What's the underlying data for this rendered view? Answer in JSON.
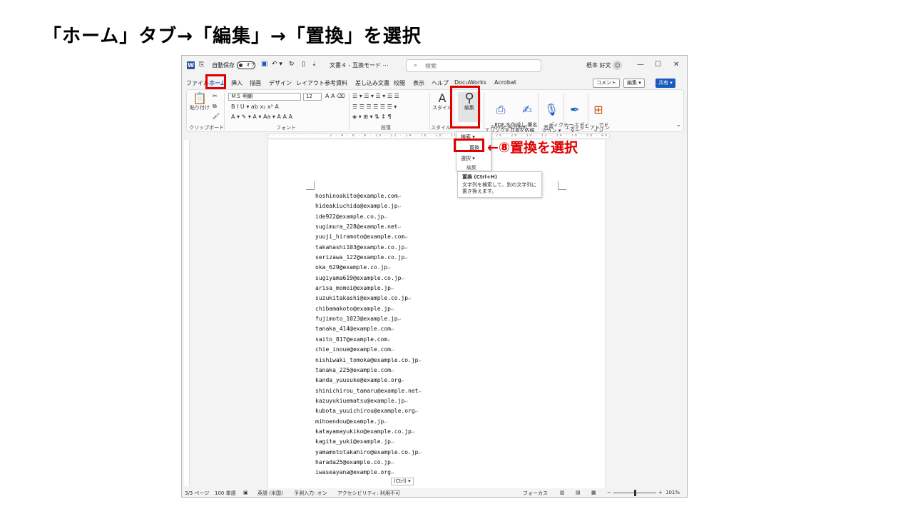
{
  "slide": {
    "title": "「ホーム」タブ→「編集」→「置換」を選択",
    "annotation": "←⑧置換を選択"
  },
  "titlebar": {
    "app_icon": "W",
    "autosave_label": "自動保存",
    "autosave_state": "オフ",
    "undo": "↶ ▾",
    "redo": "↻",
    "doc_title": "文書４ - 互換モード ⋯",
    "search_placeholder": "検索",
    "user_name": "根本 好文",
    "minimize": "—",
    "maximize": "☐",
    "close": "✕"
  },
  "tabs": [
    "ファイル",
    "ホーム",
    "挿入",
    "描画",
    "デザイン",
    "レイアウト",
    "参考資料",
    "差し込み文書",
    "校閲",
    "表示",
    "ヘルプ",
    "DocuWorks",
    "Acrobat"
  ],
  "actions": {
    "comment": "コメント",
    "edit_mode": "編集 ▾",
    "share": "共有 ▾"
  },
  "ribbon": {
    "clipboard": {
      "paste": "貼り付け",
      "label": "クリップボード"
    },
    "font": {
      "name": "ＭＳ 明朝",
      "size": "12",
      "row2": "B  I  U ▾  ab  x₂  x²  A",
      "row3": "A ▾  ✎ ▾  A ▾  Aa ▾  A  A  A",
      "label": "フォント"
    },
    "paragraph": {
      "row1": "☰ ▾  ☰ ▾  ☰ ▾  ☰  ☰",
      "row2": "☰  ☰  ☰  ☰  ☰  ☰ ▾",
      "row3": "◈ ▾  ⊞ ▾  ⇅  ↕  ¶",
      "label": "段落"
    },
    "style": {
      "btn": "スタイル",
      "label": "スタイル"
    },
    "edit": {
      "btn": "編集",
      "label": "編集"
    },
    "acrobat": {
      "pdf": "PDF を作成し\nてリンクを共有",
      "sign": "署名\nを依頼",
      "label": "Adobe Acrobat"
    },
    "voice": {
      "btn": "ディクテー\nション ▾",
      "label": "音声"
    },
    "editor": {
      "btn": "エディ\nター",
      "label": "エディター"
    },
    "addin": {
      "btn": "アド\nイン",
      "label": "アドイン"
    }
  },
  "ruler": {
    "ticks": "· · · · · · · · · · · · 2 · 4 · 6 · 8 · 10 · 12 · 14 · 16 · 18 · 20 · 22 · 24 · 26 · 28 · 30 · 32 · 34 · 36 · 38 · 40 · 42"
  },
  "edit_menu": {
    "search": "検索 ▾",
    "replace": "置換",
    "select": "選択 ▾",
    "group": "編集"
  },
  "tooltip": {
    "title": "置換 (Ctrl+H)",
    "body": "文字列を検索して、別の文字列に置き換えます。"
  },
  "document": {
    "lines": [
      "hoshinoakito@example.com",
      "hideakiuchida@example.jp",
      "ide922@example.co.jp",
      "sugimura_228@example.net",
      "yuuji_hiramoto@example.com",
      "takahashi103@example.co.jp",
      "serizawa_122@example.co.jp",
      "oka_629@example.co.jp",
      "sugiyama619@example.co.jp",
      "arisa_momoi@example.jp",
      "suzukitakashi@example.co.jp",
      "chibamakoto@example.jp",
      "fujimoto_1023@example.jp",
      "tanaka_414@example.com",
      "saito_817@example.com",
      "chie_inoue@example.com",
      "nishiwaki_tomoka@example.co.jp",
      "tanaka_225@example.com",
      "kanda_yuusuke@example.org",
      "shinichirou_tamaru@example.net",
      "kazuyukiuematsu@example.jp",
      "kubota_yuuichirou@example.org",
      "mihoendou@example.jp",
      "katayamayukiko@example.co.jp",
      "kagita_yuki@example.jp",
      "yamamototakahiro@example.co.jp",
      "harada25@example.co.jp",
      "iwaseayana@example.org"
    ],
    "paste_tag": "(Ctrl) ▾"
  },
  "statusbar": {
    "page": "3/3 ページ",
    "words": "100 単語",
    "lang": "英語 (米国)",
    "predict": "予測入力: オン",
    "access": "アクセシビリティ: 利用不可",
    "focus": "フォーカス",
    "zoom": "101%"
  },
  "colors": {
    "accent": "#185abd",
    "highlight": "#e00000"
  }
}
